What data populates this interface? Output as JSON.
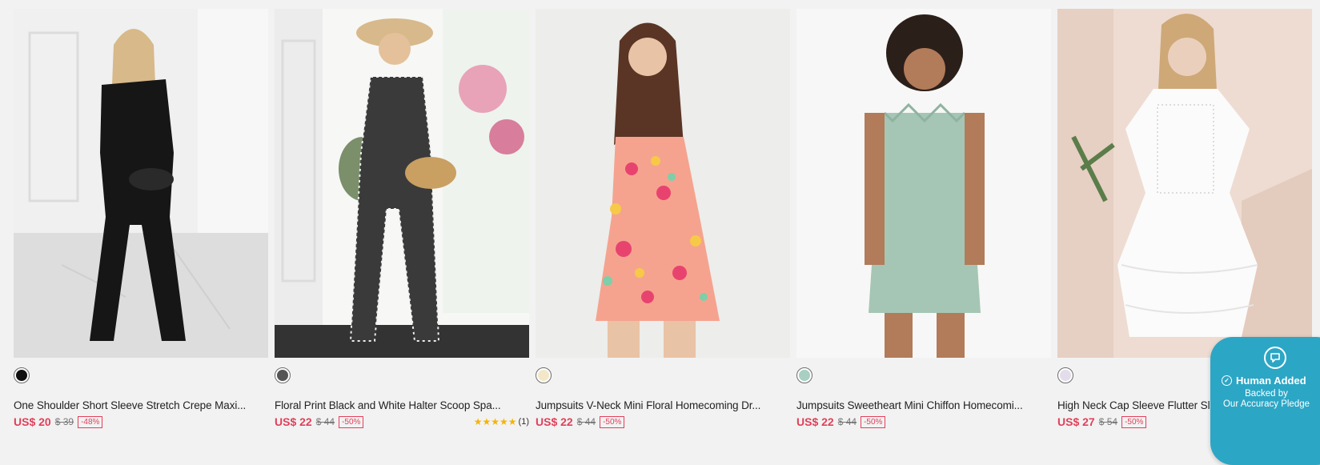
{
  "products": [
    {
      "swatch_color": "#111111",
      "title": "One Shoulder Short Sleeve Stretch Crepe Maxi...",
      "price": "US$ 20",
      "original_price": "$ 39",
      "discount": "-48%"
    },
    {
      "swatch_color": "#555555",
      "title": "Floral Print Black and White Halter Scoop Spa...",
      "price": "US$ 22",
      "original_price": "$ 44",
      "discount": "-50%",
      "rating_stars": "★★★★★",
      "rating_count": "(1)"
    },
    {
      "swatch_color": "#f3e7c9",
      "title": "Jumpsuits V-Neck Mini Floral Homecoming Dr...",
      "price": "US$ 22",
      "original_price": "$ 44",
      "discount": "-50%"
    },
    {
      "swatch_color": "#a9cfc2",
      "title": "Jumpsuits Sweetheart Mini Chiffon Homecomi...",
      "price": "US$ 22",
      "original_price": "$ 44",
      "discount": "-50%"
    },
    {
      "swatch_color": "#e3dcea",
      "title": "High Neck Cap Sleeve Flutter Sleeve Cr...",
      "price": "US$ 27",
      "original_price": "$ 54",
      "discount": "-50%"
    }
  ],
  "badge": {
    "line1": "Human Added",
    "line2": "Backed by",
    "line3": "Our Accuracy Pledge",
    "color": "#2ca6c5"
  }
}
